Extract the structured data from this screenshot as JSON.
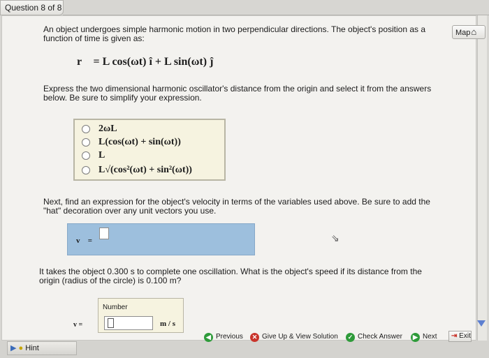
{
  "question_tab": "Question 8 of 8",
  "map_button": "Map",
  "problem": {
    "intro_line1": "An object undergoes simple harmonic motion in two perpendicular directions. The object's position as a",
    "intro_line2": "function of time is given as:",
    "equation": "r⃗ = L cos(ωt) î + L sin(ωt) ĵ",
    "part1_line1": "Express the two dimensional harmonic oscillator's distance from the origin and select it from the answers",
    "part1_line2": "below. Be sure to simplify your expression."
  },
  "choices": [
    "2ωL",
    "L(cos(ωt) + sin(ωt))",
    "L",
    "L√(cos²(ωt) + sin²(ωt))"
  ],
  "part2": {
    "line1": "Next, find an expression for the object's velocity in terms of the variables used above. Be sure to add the",
    "line2": "\"hat\" decoration over any unit vectors you use.",
    "var_label": "v⃗ ="
  },
  "part3": {
    "line1": "It takes the object 0.300 s to complete one oscillation. What is the object's speed if its distance from the",
    "line2": "origin (radius of the circle) is 0.100 m?",
    "number_label": "Number",
    "var_label": "v =",
    "unit": "m / s"
  },
  "footer": {
    "hint": "Hint",
    "previous": "Previous",
    "give_up": "Give Up & View Solution",
    "check_answer": "Check Answer",
    "next": "Next",
    "exit": "Exit"
  },
  "colors": {
    "answer_box": "#9dbfdd",
    "choice_box": "#f6f3e0",
    "previous_icon": "#2e9b3a",
    "give_up_icon": "#c9342b",
    "check_icon": "#2e9b3a",
    "next_icon": "#2e9b3a",
    "exit_icon": "#c9342b"
  }
}
